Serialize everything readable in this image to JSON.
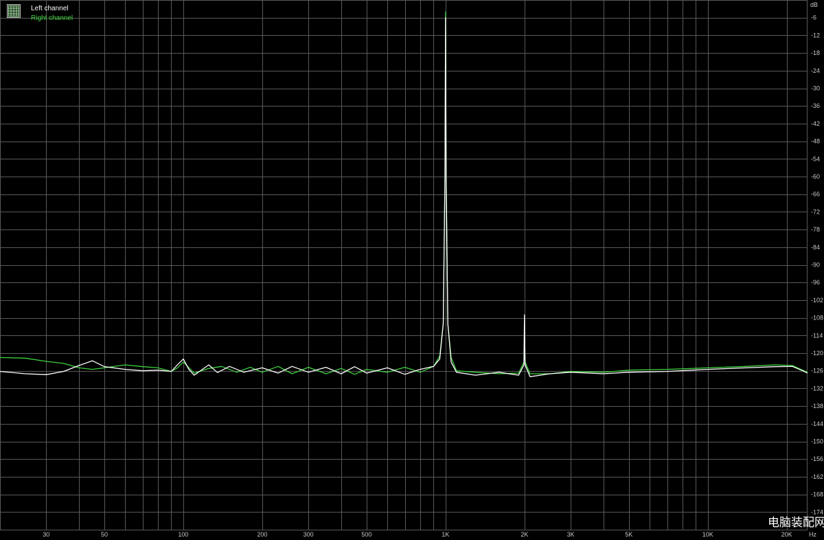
{
  "chart_data": {
    "type": "line",
    "title": "",
    "xlabel": "Hz",
    "ylabel": "dB",
    "x_scale": "log",
    "xlim": [
      20,
      24000
    ],
    "ylim": [
      -180,
      0
    ],
    "x_ticks": [
      {
        "value": 30,
        "label": "30"
      },
      {
        "value": 50,
        "label": "50"
      },
      {
        "value": 100,
        "label": "100"
      },
      {
        "value": 200,
        "label": "200"
      },
      {
        "value": 300,
        "label": "300"
      },
      {
        "value": 500,
        "label": "500"
      },
      {
        "value": 1000,
        "label": "1K"
      },
      {
        "value": 2000,
        "label": "2K"
      },
      {
        "value": 3000,
        "label": "3K"
      },
      {
        "value": 5000,
        "label": "5K"
      },
      {
        "value": 10000,
        "label": "10K"
      },
      {
        "value": 20000,
        "label": "20K"
      }
    ],
    "y_ticks": [
      -6,
      -12,
      -18,
      -24,
      -30,
      -36,
      -42,
      -48,
      -54,
      -60,
      -66,
      -72,
      -78,
      -84,
      -90,
      -96,
      -102,
      -108,
      -114,
      -120,
      -126,
      -132,
      -138,
      -144,
      -150,
      -156,
      -162,
      -168,
      -174
    ],
    "grid": true,
    "legend_position": "top-left",
    "series": [
      {
        "name": "Left channel",
        "color": "#ffffff",
        "points": [
          [
            20,
            -126.2
          ],
          [
            25,
            -127.0
          ],
          [
            30,
            -127.3
          ],
          [
            35,
            -126.2
          ],
          [
            40,
            -124.2
          ],
          [
            45,
            -122.6
          ],
          [
            50,
            -124.6
          ],
          [
            60,
            -125.5
          ],
          [
            70,
            -126.0
          ],
          [
            80,
            -125.8
          ],
          [
            90,
            -126.2
          ],
          [
            95,
            -124.0
          ],
          [
            100,
            -122.0
          ],
          [
            105,
            -125.5
          ],
          [
            110,
            -127.5
          ],
          [
            125,
            -124.0
          ],
          [
            135,
            -126.6
          ],
          [
            150,
            -124.5
          ],
          [
            170,
            -126.5
          ],
          [
            200,
            -125.0
          ],
          [
            230,
            -126.8
          ],
          [
            260,
            -124.5
          ],
          [
            300,
            -126.5
          ],
          [
            350,
            -124.8
          ],
          [
            400,
            -127.0
          ],
          [
            450,
            -124.6
          ],
          [
            500,
            -126.8
          ],
          [
            600,
            -125.0
          ],
          [
            700,
            -127.2
          ],
          [
            800,
            -125.5
          ],
          [
            900,
            -124.5
          ],
          [
            950,
            -122.0
          ],
          [
            980,
            -110.0
          ],
          [
            995,
            -60.0
          ],
          [
            1000,
            -6.0
          ],
          [
            1005,
            -60.0
          ],
          [
            1020,
            -110.0
          ],
          [
            1050,
            -123.0
          ],
          [
            1100,
            -126.5
          ],
          [
            1300,
            -127.5
          ],
          [
            1600,
            -126.5
          ],
          [
            1900,
            -127.5
          ],
          [
            1990,
            -124.0
          ],
          [
            2000,
            -107.0
          ],
          [
            2010,
            -124.0
          ],
          [
            2100,
            -128.0
          ],
          [
            2500,
            -127.0
          ],
          [
            3000,
            -126.5
          ],
          [
            4000,
            -127.0
          ],
          [
            5000,
            -126.5
          ],
          [
            7000,
            -126.2
          ],
          [
            10000,
            -125.5
          ],
          [
            14000,
            -125.0
          ],
          [
            18000,
            -124.6
          ],
          [
            21000,
            -124.5
          ],
          [
            23000,
            -126.0
          ],
          [
            24000,
            -126.8
          ]
        ]
      },
      {
        "name": "Right channel",
        "color": "#3fd23f",
        "points": [
          [
            20,
            -121.5
          ],
          [
            25,
            -121.7
          ],
          [
            30,
            -122.8
          ],
          [
            35,
            -123.5
          ],
          [
            40,
            -125.0
          ],
          [
            45,
            -125.5
          ],
          [
            50,
            -125.0
          ],
          [
            60,
            -124.0
          ],
          [
            70,
            -124.6
          ],
          [
            80,
            -125.0
          ],
          [
            90,
            -126.2
          ],
          [
            95,
            -125.0
          ],
          [
            100,
            -123.0
          ],
          [
            110,
            -126.8
          ],
          [
            125,
            -125.2
          ],
          [
            140,
            -124.5
          ],
          [
            160,
            -126.5
          ],
          [
            180,
            -124.8
          ],
          [
            200,
            -126.5
          ],
          [
            230,
            -124.5
          ],
          [
            260,
            -127.0
          ],
          [
            300,
            -124.8
          ],
          [
            350,
            -127.0
          ],
          [
            400,
            -125.2
          ],
          [
            450,
            -127.2
          ],
          [
            500,
            -125.5
          ],
          [
            600,
            -126.5
          ],
          [
            700,
            -124.8
          ],
          [
            800,
            -126.5
          ],
          [
            900,
            -124.5
          ],
          [
            950,
            -121.0
          ],
          [
            980,
            -110.0
          ],
          [
            995,
            -60.0
          ],
          [
            1000,
            -4.0
          ],
          [
            1005,
            -60.0
          ],
          [
            1020,
            -110.0
          ],
          [
            1050,
            -121.5
          ],
          [
            1100,
            -126.0
          ],
          [
            1300,
            -126.5
          ],
          [
            1600,
            -127.0
          ],
          [
            1900,
            -126.8
          ],
          [
            1990,
            -123.0
          ],
          [
            2000,
            -113.0
          ],
          [
            2010,
            -123.0
          ],
          [
            2100,
            -127.0
          ],
          [
            2500,
            -127.0
          ],
          [
            3000,
            -126.2
          ],
          [
            4000,
            -126.5
          ],
          [
            5000,
            -125.8
          ],
          [
            7000,
            -125.5
          ],
          [
            10000,
            -125.0
          ],
          [
            14000,
            -124.5
          ],
          [
            18000,
            -124.0
          ],
          [
            21000,
            -124.2
          ],
          [
            23000,
            -125.8
          ],
          [
            24000,
            -126.5
          ]
        ]
      }
    ]
  },
  "watermark": {
    "text": "电脑装配网"
  },
  "colors": {
    "background": "#000000",
    "grid": "#5a5a5a",
    "axis_text": "#c8c8c8",
    "left_channel": "#ffffff",
    "right_channel": "#3fd23f"
  }
}
